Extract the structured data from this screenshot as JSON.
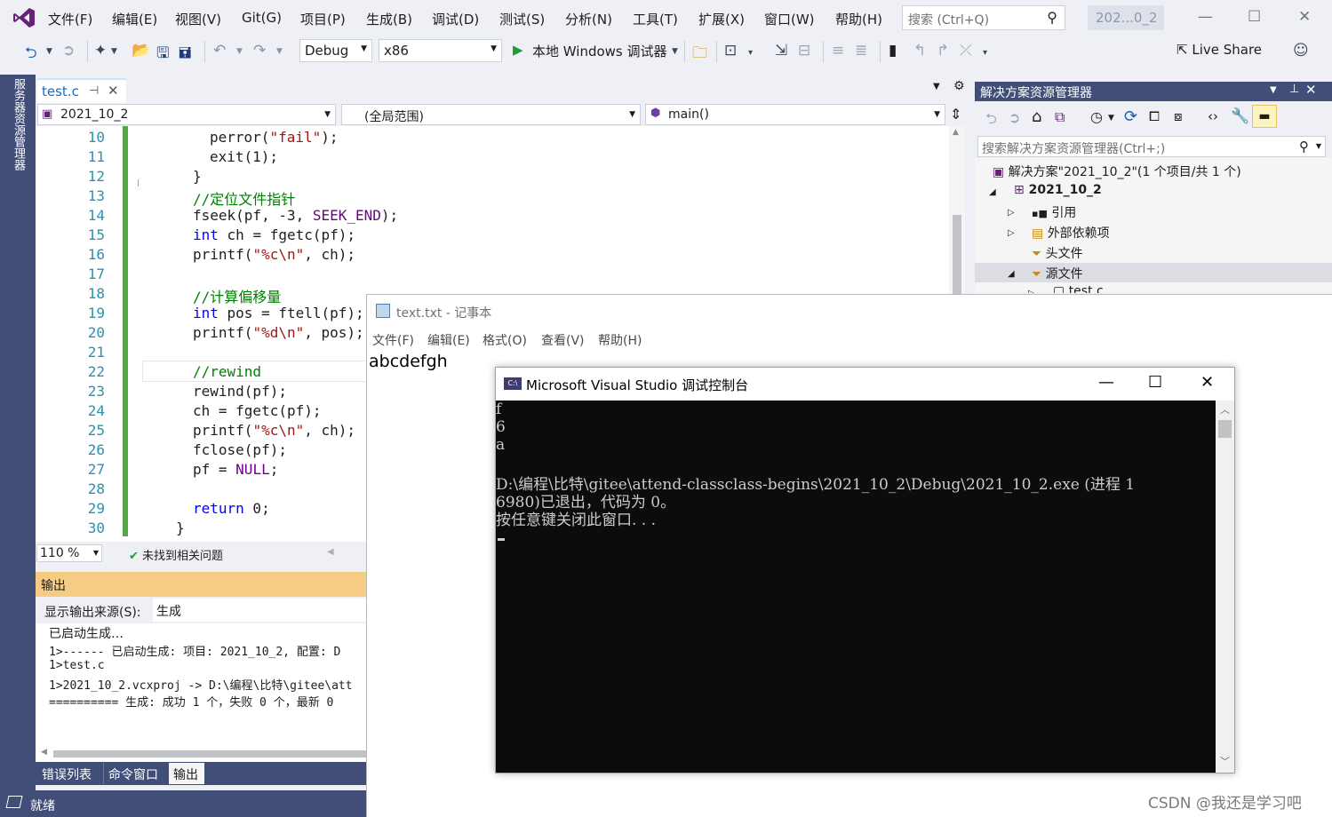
{
  "menubar": {
    "items": [
      "文件(F)",
      "编辑(E)",
      "视图(V)",
      "Git(G)",
      "项目(P)",
      "生成(B)",
      "调试(D)",
      "测试(S)",
      "分析(N)",
      "工具(T)",
      "扩展(X)",
      "窗口(W)",
      "帮助(H)"
    ],
    "search_placeholder": "搜索 (Ctrl+Q)",
    "solution_badge": "202...0_2"
  },
  "toolbar": {
    "config": "Debug",
    "platform": "x86",
    "run_label": "本地 Windows 调试器",
    "liveshare": "Live Share"
  },
  "left_strip": {
    "server_explorer": "服务器资源管理器"
  },
  "editor": {
    "tab_label": "test.c",
    "nav_project": "2021_10_2",
    "nav_scope": "(全局范围)",
    "nav_member": "main()",
    "zoom": "110 %",
    "issues": "未找到相关问题",
    "lines": [
      {
        "n": "10",
        "indent": 4,
        "tokens": [
          {
            "t": "perror(",
            "c": ""
          },
          {
            "t": "\"fail\"",
            "c": "st"
          },
          {
            "t": ");",
            "c": ""
          }
        ]
      },
      {
        "n": "11",
        "indent": 4,
        "tokens": [
          {
            "t": "exit(1);",
            "c": ""
          }
        ]
      },
      {
        "n": "12",
        "indent": 2,
        "tokens": [
          {
            "t": "}",
            "c": ""
          }
        ]
      },
      {
        "n": "13",
        "indent": 2,
        "tokens": [
          {
            "t": "//定位文件指针",
            "c": "cm"
          }
        ]
      },
      {
        "n": "14",
        "indent": 2,
        "tokens": [
          {
            "t": "fseek(pf, -3, ",
            "c": ""
          },
          {
            "t": "SEEK_END",
            "c": "mc"
          },
          {
            "t": ");",
            "c": ""
          }
        ]
      },
      {
        "n": "15",
        "indent": 2,
        "tokens": [
          {
            "t": "int",
            "c": "kw"
          },
          {
            "t": " ch = fgetc(pf);",
            "c": ""
          }
        ]
      },
      {
        "n": "16",
        "indent": 2,
        "tokens": [
          {
            "t": "printf(",
            "c": ""
          },
          {
            "t": "\"%c\\n\"",
            "c": "st"
          },
          {
            "t": ", ch);",
            "c": ""
          }
        ]
      },
      {
        "n": "17",
        "indent": 0,
        "tokens": []
      },
      {
        "n": "18",
        "indent": 2,
        "tokens": [
          {
            "t": "//计算偏移量",
            "c": "cm"
          }
        ]
      },
      {
        "n": "19",
        "indent": 2,
        "tokens": [
          {
            "t": "int",
            "c": "kw"
          },
          {
            "t": " pos = ftell(pf);",
            "c": ""
          }
        ]
      },
      {
        "n": "20",
        "indent": 2,
        "tokens": [
          {
            "t": "printf(",
            "c": ""
          },
          {
            "t": "\"%d\\n\"",
            "c": "st"
          },
          {
            "t": ", pos);",
            "c": ""
          }
        ]
      },
      {
        "n": "21",
        "indent": 0,
        "tokens": []
      },
      {
        "n": "22",
        "indent": 2,
        "tokens": [
          {
            "t": "//rewind",
            "c": "cm"
          }
        ]
      },
      {
        "n": "23",
        "indent": 2,
        "tokens": [
          {
            "t": "rewind(pf);",
            "c": ""
          }
        ]
      },
      {
        "n": "24",
        "indent": 2,
        "tokens": [
          {
            "t": "ch = fgetc(pf);",
            "c": ""
          }
        ]
      },
      {
        "n": "25",
        "indent": 2,
        "tokens": [
          {
            "t": "printf(",
            "c": ""
          },
          {
            "t": "\"%c\\n\"",
            "c": "st"
          },
          {
            "t": ", ch);",
            "c": ""
          }
        ]
      },
      {
        "n": "26",
        "indent": 2,
        "tokens": [
          {
            "t": "fclose(pf);",
            "c": ""
          }
        ]
      },
      {
        "n": "27",
        "indent": 2,
        "tokens": [
          {
            "t": "pf = ",
            "c": ""
          },
          {
            "t": "NULL",
            "c": "mc"
          },
          {
            "t": ";",
            "c": ""
          }
        ]
      },
      {
        "n": "28",
        "indent": 0,
        "tokens": []
      },
      {
        "n": "29",
        "indent": 2,
        "tokens": [
          {
            "t": "return",
            "c": "kw"
          },
          {
            "t": " 0;",
            "c": ""
          }
        ]
      },
      {
        "n": "30",
        "indent": 0,
        "tokens": [
          {
            "t": "}",
            "c": ""
          }
        ]
      }
    ]
  },
  "output": {
    "title": "输出",
    "source_label": "显示输出来源(S):",
    "source_value": "生成",
    "lines": [
      "已启动生成…",
      "1>------ 已启动生成: 项目: 2021_10_2, 配置: D",
      "1>test.c",
      "1>2021_10_2.vcxproj -> D:\\编程\\比特\\gitee\\att",
      "========== 生成: 成功 1 个，失败 0 个，最新 0"
    ],
    "tabs": [
      "错误列表",
      "命令窗口",
      "输出"
    ]
  },
  "statusbar": {
    "text": "就绪"
  },
  "solution_explorer": {
    "title": "解决方案资源管理器",
    "search_placeholder": "搜索解决方案资源管理器(Ctrl+;)",
    "solution": "解决方案\"2021_10_2\"(1 个项目/共 1 个)",
    "project": "2021_10_2",
    "items": [
      "引用",
      "外部依赖项",
      "头文件",
      "源文件",
      "test.c"
    ]
  },
  "notepad": {
    "title": "text.txt - 记事本",
    "menu": [
      "文件(F)",
      "编辑(E)",
      "格式(O)",
      "查看(V)",
      "帮助(H)"
    ],
    "content": "abcdefgh"
  },
  "console": {
    "title": "Microsoft Visual Studio 调试控制台",
    "icon_label": "C:\\",
    "lines": [
      "f",
      "6",
      "a",
      "",
      "D:\\编程\\比特\\gitee\\attend-classclass-begins\\2021_10_2\\Debug\\2021_10_2.exe (进程 1",
      "6980)已退出，代码为 0。",
      "按任意键关闭此窗口. . ."
    ]
  },
  "watermark": "CSDN @我还是学习吧",
  "colors": {
    "accent": "#404e78",
    "output_title_bg": "#f5cc84",
    "keyword": "#0000ff",
    "comment": "#008000",
    "string": "#a31515",
    "macro": "#6f008a",
    "line_number": "#2b91af",
    "change_bar": "#57a64a"
  }
}
